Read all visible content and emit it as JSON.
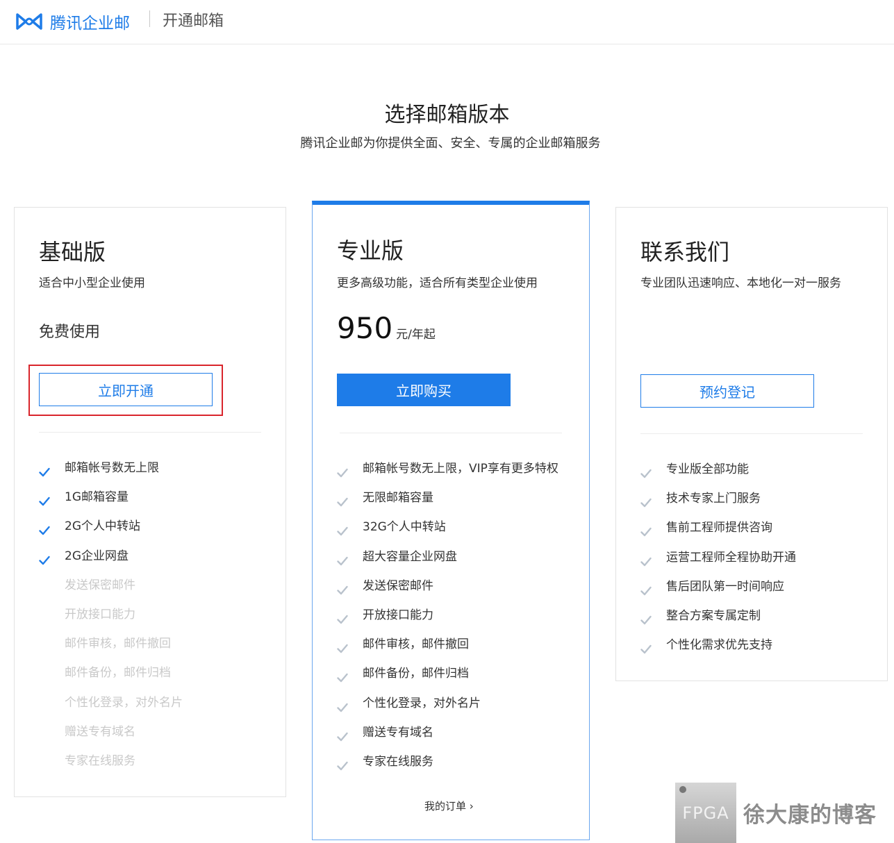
{
  "header": {
    "brand": "腾讯企业邮",
    "section": "开通邮箱"
  },
  "page": {
    "title": "选择邮箱版本",
    "subtitle": "腾讯企业邮为你提供全面、安全、专属的企业邮箱服务"
  },
  "colors": {
    "accent": "#1e7ce8",
    "highlight": "#d9242b",
    "disabled_text": "#c9c9c9"
  },
  "plans": {
    "basic": {
      "name": "基础版",
      "desc": "适合中小型企业使用",
      "price_text": "免费使用",
      "button": "立即开通",
      "features": [
        {
          "text": "邮箱帐号数无上限",
          "enabled": true
        },
        {
          "text": "1G邮箱容量",
          "enabled": true
        },
        {
          "text": "2G个人中转站",
          "enabled": true
        },
        {
          "text": "2G企业网盘",
          "enabled": true
        },
        {
          "text": "发送保密邮件",
          "enabled": false
        },
        {
          "text": "开放接口能力",
          "enabled": false
        },
        {
          "text": "邮件审核，邮件撤回",
          "enabled": false
        },
        {
          "text": "邮件备份，邮件归档",
          "enabled": false
        },
        {
          "text": "个性化登录，对外名片",
          "enabled": false
        },
        {
          "text": "赠送专有域名",
          "enabled": false
        },
        {
          "text": "专家在线服务",
          "enabled": false
        }
      ]
    },
    "pro": {
      "name": "专业版",
      "desc": "更多高级功能，适合所有类型企业使用",
      "price": "950",
      "price_unit": "元/年起",
      "button": "立即购买",
      "features": [
        "邮箱帐号数无上限，VIP享有更多特权",
        "无限邮箱容量",
        "32G个人中转站",
        "超大容量企业网盘",
        "发送保密邮件",
        "开放接口能力",
        "邮件审核，邮件撤回",
        "邮件备份，邮件归档",
        "个性化登录，对外名片",
        "赠送专有域名",
        "专家在线服务"
      ],
      "orders_link": "我的订单 ›"
    },
    "contact": {
      "name": "联系我们",
      "desc": "专业团队迅速响应、本地化一对一服务",
      "button": "预约登记",
      "features": [
        "专业版全部功能",
        "技术专家上门服务",
        "售前工程师提供咨询",
        "运营工程师全程协助开通",
        "售后团队第一时间响应",
        "整合方案专属定制",
        "个性化需求优先支持"
      ]
    }
  },
  "watermark": {
    "badge": "FPGA",
    "text": "徐大康的博客"
  }
}
